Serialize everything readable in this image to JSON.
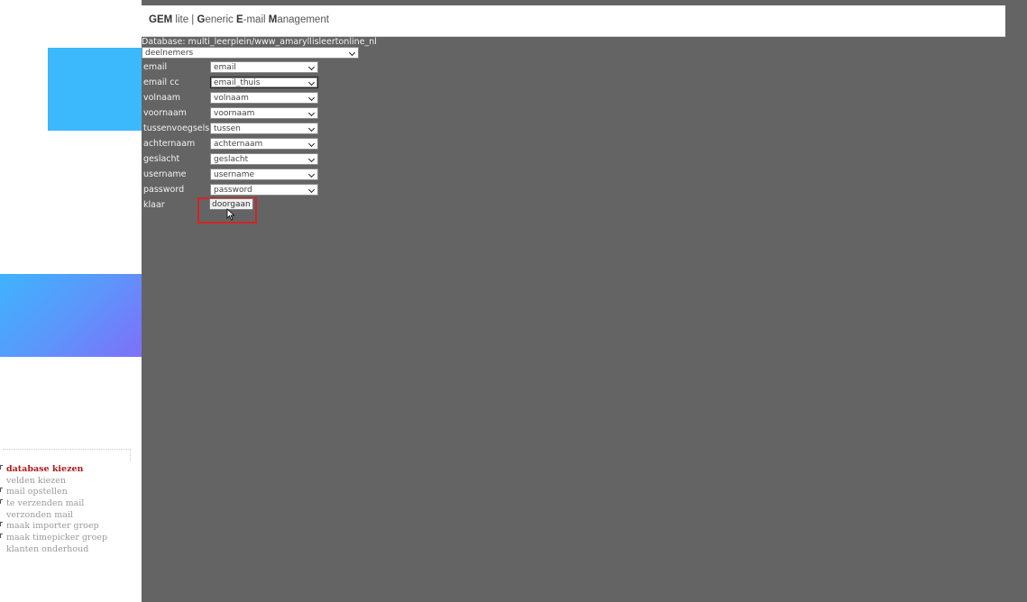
{
  "header": {
    "title_parts": [
      {
        "text": "GEM",
        "bold": true
      },
      {
        "text": " lite | ",
        "bold": false
      },
      {
        "text": "G",
        "bold": true
      },
      {
        "text": "eneric ",
        "bold": false
      },
      {
        "text": "E",
        "bold": true
      },
      {
        "text": "-mail ",
        "bold": false
      },
      {
        "text": "M",
        "bold": true
      },
      {
        "text": "anagement",
        "bold": false
      }
    ]
  },
  "database_label": "Database: multi_leerplein/www_amaryllisleertonline_nl",
  "table_select": {
    "value": "deelnemers"
  },
  "fields": [
    {
      "label": "email",
      "value": "email"
    },
    {
      "label": "email cc",
      "value": "email_thuis"
    },
    {
      "label": "volnaam",
      "value": "volnaam"
    },
    {
      "label": "voornaam",
      "value": "voornaam"
    },
    {
      "label": "tussenvoegsels",
      "value": "tussen"
    },
    {
      "label": "achternaam",
      "value": "achternaam"
    },
    {
      "label": "geslacht",
      "value": "geslacht"
    },
    {
      "label": "username",
      "value": "username"
    },
    {
      "label": "password",
      "value": "password"
    }
  ],
  "submit": {
    "label": "klaar",
    "button": "doorgaan"
  },
  "nav": {
    "items": [
      {
        "label": "database kiezen",
        "active": true
      },
      {
        "label": "velden kiezen",
        "active": false
      },
      {
        "label": "mail opstellen",
        "active": false
      },
      {
        "label": "te verzenden mail",
        "active": false
      },
      {
        "label": "verzonden mail",
        "active": false
      },
      {
        "label": "maak importer groep",
        "active": false
      },
      {
        "label": "maak timepicker groep",
        "active": false
      },
      {
        "label": "klanten onderhoud",
        "active": false
      }
    ]
  },
  "colors": {
    "active_nav": "#b01919",
    "highlight": "#d42323",
    "main_bg": "#646464"
  }
}
